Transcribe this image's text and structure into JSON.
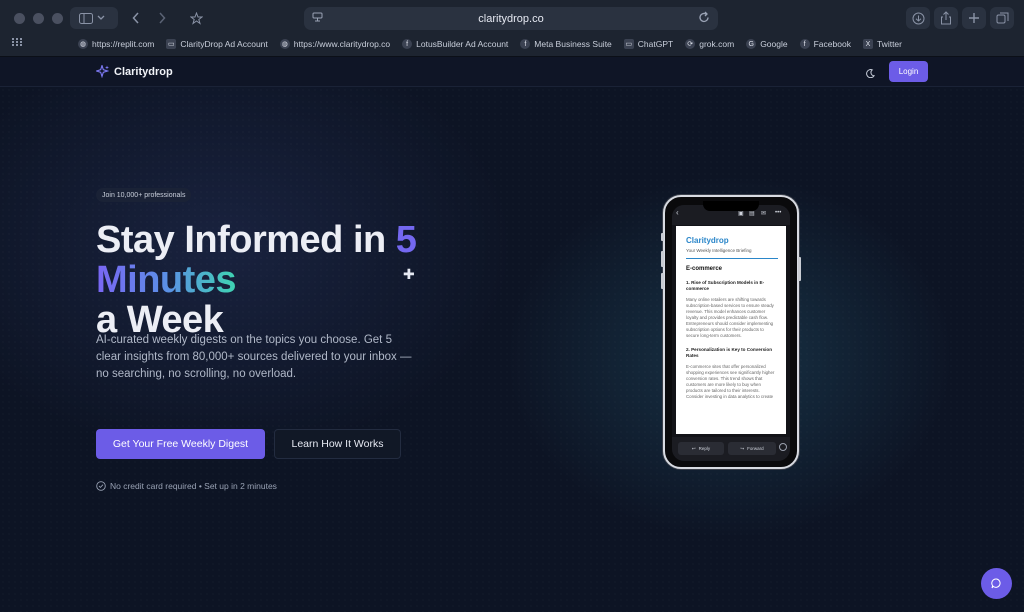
{
  "browser": {
    "url": "claritydrop.co",
    "bookmarks": [
      {
        "label": "https://replit.com",
        "icon": "globe-icon"
      },
      {
        "label": "ClarityDrop Ad Account",
        "icon": "bookmark-icon"
      },
      {
        "label": "https://www.claritydrop.co",
        "icon": "globe-icon"
      },
      {
        "label": "LotusBuilder Ad Account",
        "icon": "facebook-icon"
      },
      {
        "label": "Meta Business Suite",
        "icon": "facebook-icon"
      },
      {
        "label": "ChatGPT",
        "icon": "bookmark-icon"
      },
      {
        "label": "grok.com",
        "icon": "grok-icon"
      },
      {
        "label": "Google",
        "icon": "google-icon"
      },
      {
        "label": "Facebook",
        "icon": "facebook-icon"
      },
      {
        "label": "Twitter",
        "icon": "x-icon"
      }
    ]
  },
  "nav": {
    "brand": "Claritydrop",
    "login_label": "Login"
  },
  "hero": {
    "badge": "Join 10,000+ professionals",
    "headline_part1": "Stay Informed in ",
    "headline_num": "5",
    "headline_part2": "Minutes",
    "headline_part3": "a Week",
    "subtext": "AI-curated weekly digests on the topics you choose. Get 5 clear insights from 80,000+ sources delivered to your inbox —no searching, no scrolling, no overload.",
    "primary_cta": "Get Your Free Weekly Digest",
    "secondary_cta": "Learn How It Works",
    "note": "No credit card required • Set up in 2 minutes"
  },
  "phone_email": {
    "brand": "Claritydrop",
    "tagline": "Your Weekly Intelligence Briefing",
    "section": "E-commerce",
    "item1_title": "1. Rise of Subscription Models in E-commerce",
    "item1_body": "Many online retailers are shifting towards subscription-based services to ensure steady revenue. This model enhances customer loyalty and provides predictable cash flow. Entrepreneurs should consider implementing subscription options for their products to secure long-term customers.",
    "item2_title": "2. Personalization is Key to Conversion Rates",
    "item2_body": "E-commerce sites that offer personalized shopping experiences see significantly higher conversion rates. This trend shows that customers are more likely to buy when products are tailored to their interests. Consider investing in data analytics to create",
    "reply_label": "Reply",
    "forward_label": "Forward"
  },
  "colors": {
    "accent": "#6c5ce7",
    "background": "#0d1424",
    "email_brand": "#2a86c9"
  }
}
